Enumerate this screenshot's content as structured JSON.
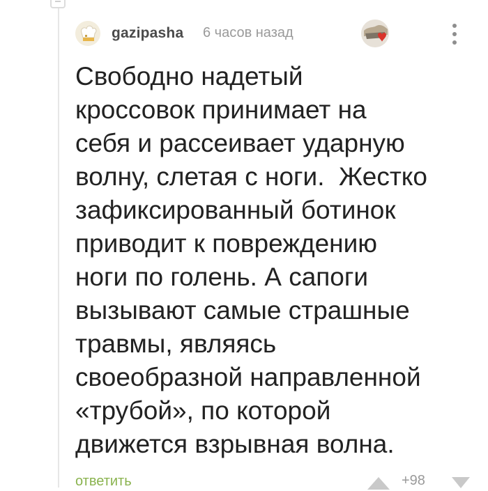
{
  "comment": {
    "author": "gazipasha",
    "time": "6 часов назад",
    "text": "Свободно надетый\nкроссовок принимает на\nсебя и рассеивает ударную\nволну, слетая с ноги.  Жестко\nзафиксированный ботинок\nприводит к повреждению\nноги по голень. А сапоги\nвызывают самые страшные\nтравмы, являясь\nсвоеобразной направленной\n«трубой», по которой\nдвижется взрывная волна.",
    "reply_label": "ответить",
    "rating": "+98"
  },
  "icons": {
    "collapse": "collapse-thread-icon",
    "avatar": "chef-hat-avatar",
    "badge": "heart-award-badge-icon",
    "more": "vertical-dots-more-icon",
    "upvote": "triangle-up-icon",
    "downvote": "triangle-down-icon"
  },
  "colors": {
    "reply": "#8ab34f",
    "meta": "#9a9a9a",
    "text": "#222222",
    "badge_heart": "#d9342b"
  }
}
